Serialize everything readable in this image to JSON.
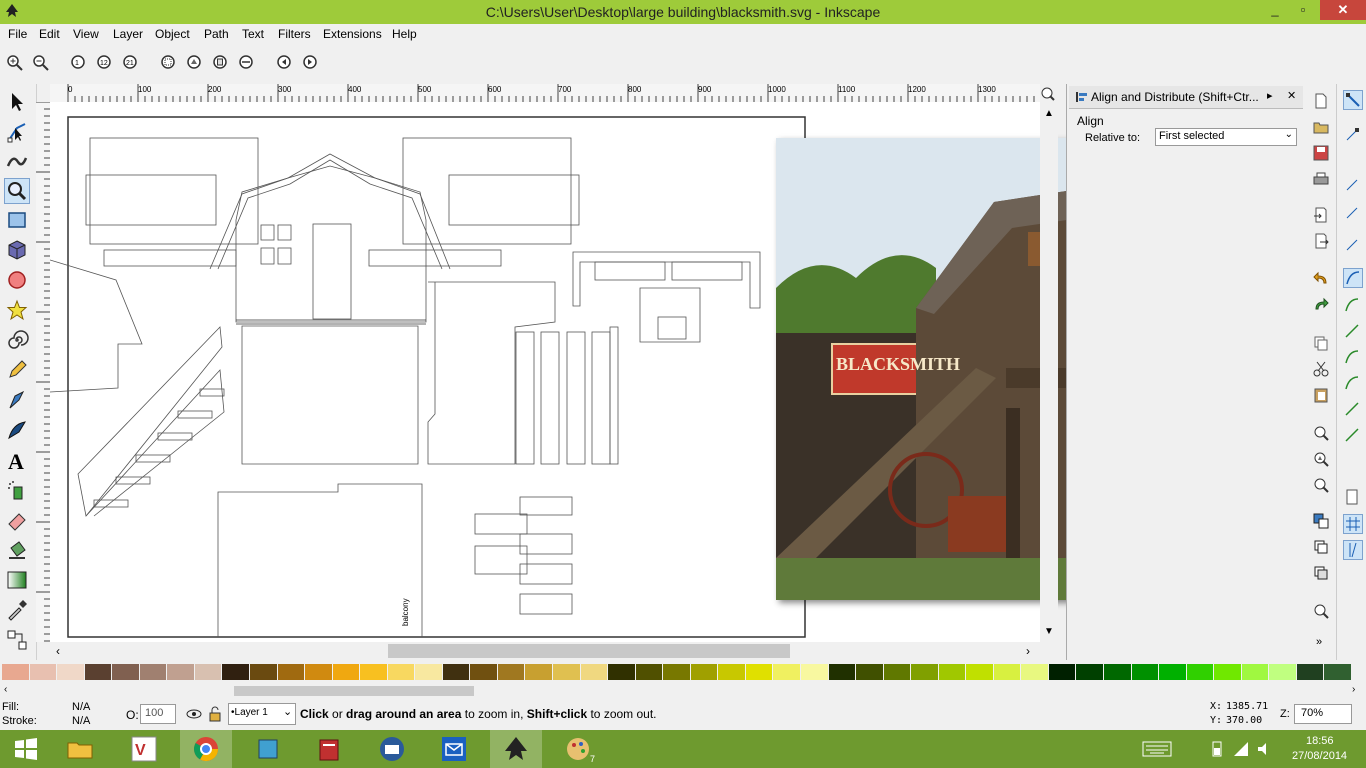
{
  "window": {
    "title": "C:\\Users\\User\\Desktop\\large building\\blacksmith.svg - Inkscape",
    "minimize": "_",
    "maximize": "▫",
    "close": "✕"
  },
  "menu": [
    "File",
    "Edit",
    "View",
    "Layer",
    "Object",
    "Path",
    "Text",
    "Filters",
    "Extensions",
    "Help"
  ],
  "ruler_ticks": [
    "0",
    "100",
    "200",
    "300",
    "400",
    "500",
    "600",
    "700",
    "800",
    "900",
    "1000",
    "1100",
    "1200",
    "1300"
  ],
  "vruler_ticks": [
    "0",
    "0",
    "0",
    "0",
    "0",
    "0",
    "0",
    "0",
    "0"
  ],
  "canvas": {
    "label_balcony": "balcony"
  },
  "photo": {
    "sign_text": "BLACKSMITH"
  },
  "dock": {
    "title": "Align and Distribute (Shift+Ctr...",
    "section": "Align",
    "relative_label": "Relative to:",
    "relative_value": "First selected"
  },
  "status": {
    "fill_label": "Fill:",
    "fill_value": "N/A",
    "stroke_label": "Stroke:",
    "stroke_value": "N/A",
    "opacity_label": "O:",
    "opacity_value": "100",
    "layer": "•Layer 1",
    "message_b1": "Click",
    "message_t1": " or ",
    "message_b2": "drag around an area",
    "message_t2": " to zoom in, ",
    "message_b3": "Shift+click",
    "message_t3": " to zoom out.",
    "x_label": "X:",
    "x_value": "1385.71",
    "y_label": "Y:",
    "y_value": "370.00",
    "zoom_label": "Z:",
    "zoom_value": "70%"
  },
  "taskbar": {
    "time": "18:56",
    "date": "27/08/2014",
    "badge": "7"
  },
  "colors": {
    "titlebar": "#9ecb3a",
    "taskbar": "#6e9a2f",
    "close": "#c7463c",
    "sign": "#c0392b"
  },
  "palette": [
    "#e8a890",
    "#e8c0b0",
    "#f0d8c8",
    "#5a4030",
    "#806050",
    "#a08070",
    "#c0a090",
    "#d8c0b0",
    "#302010",
    "#6a4a10",
    "#a06a10",
    "#d08a10",
    "#f0a810",
    "#f8c020",
    "#f8d860",
    "#f8e8a0",
    "#403010",
    "#705010",
    "#a07820",
    "#c8a030",
    "#e0c050",
    "#f0d880",
    "#303000",
    "#505000",
    "#787800",
    "#a0a000",
    "#c8c800",
    "#e0e000",
    "#f0f060",
    "#f8f8a0",
    "#203000",
    "#405000",
    "#607800",
    "#80a000",
    "#a0c800",
    "#c0e000",
    "#d8f040",
    "#e8f880",
    "#002000",
    "#004000",
    "#006800",
    "#009000",
    "#00b000",
    "#30d000",
    "#70e800",
    "#a0f840",
    "#c0ff80",
    "#204020",
    "#306030"
  ],
  "icons": {
    "tools": [
      "selector-icon",
      "node-icon",
      "tweak-icon",
      "zoom-icon",
      "rect-icon",
      "3dbox-icon",
      "ellipse-icon",
      "star-icon",
      "spiral-icon",
      "pencil-icon",
      "pen-icon",
      "calligraphy-icon",
      "text-icon",
      "spray-icon",
      "eraser-icon",
      "bucket-icon",
      "gradient-icon",
      "dropper-icon",
      "connector-icon"
    ],
    "commands": [
      "zoom-in-icon",
      "zoom-out-icon",
      "zoom-1to1-icon",
      "zoom-1to2-icon",
      "zoom-2to1-icon",
      "zoom-selection-icon",
      "zoom-drawing-icon",
      "zoom-page-icon",
      "zoom-width-icon",
      "zoom-prev-icon",
      "zoom-next-icon"
    ]
  }
}
